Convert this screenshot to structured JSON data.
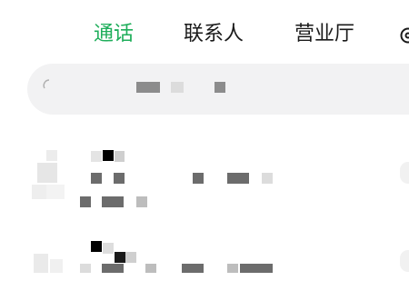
{
  "tabs": {
    "calls": "通话",
    "contacts": "联系人",
    "business_hall": "营业厅"
  },
  "icons": {
    "settings": "settings-icon",
    "search": "search-icon"
  },
  "colors": {
    "active_tab": "#1fae5b",
    "tab_text": "#1a1a1a",
    "search_bg": "#f2f2f3"
  }
}
